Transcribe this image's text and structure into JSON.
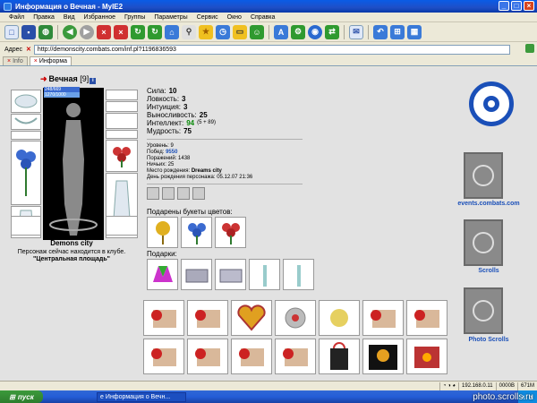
{
  "window": {
    "title": "Информация о Вечная - MyIE2"
  },
  "menu": [
    "Файл",
    "Правка",
    "Вид",
    "Избранное",
    "Группы",
    "Параметры",
    "Сервис",
    "Окно",
    "Справка"
  ],
  "address": {
    "label": "Адрес",
    "url": "http://demonscity.combats.com/inf.pl?1196836593"
  },
  "tabs": [
    {
      "label": "Info"
    },
    {
      "label": "Информа"
    }
  ],
  "character": {
    "name": "Вечная",
    "level": "[9]",
    "info_icon": "i",
    "hp": "248/669",
    "mp": "1270/1000",
    "city": "Demons city",
    "club_text": "Персонаж сейчас находится в клубе.",
    "location": "\"Центральная площадь\""
  },
  "stats": [
    {
      "label": "Сила:",
      "value": "10"
    },
    {
      "label": "Ловкость:",
      "value": "3"
    },
    {
      "label": "Интуиция:",
      "value": "3"
    },
    {
      "label": "Выносливость:",
      "value": "25"
    },
    {
      "label": "Интеллект:",
      "value": "94",
      "extra": "(5 + 89)"
    },
    {
      "label": "Мудрость:",
      "value": "75"
    }
  ],
  "info": [
    {
      "label": "Уровень:",
      "value": "9"
    },
    {
      "label": "Побед:",
      "value": "9550"
    },
    {
      "label": "Поражений:",
      "value": "1438"
    },
    {
      "label": "Ничьих:",
      "value": "25"
    },
    {
      "label": "Место рождения:",
      "value": "Dreams city"
    },
    {
      "label": "День рождения персонажа:",
      "value": "05.12.07 21:36"
    }
  ],
  "sections": {
    "bouquets": "Подарены букеты цветов:",
    "gifts": "Подарки:"
  },
  "right_links": {
    "events": "events.combats.com",
    "scrolls": "Scrolls",
    "photo": "Photo Scrolls"
  },
  "status": {
    "ip": "192.168.0.11",
    "mem1": "0000B",
    "mem2": "671M"
  },
  "taskbar": {
    "start": "пуск",
    "task": "Информация о Вечн...",
    "watermark": "photo.scrolls.ru"
  },
  "colors": {
    "titlebar": "#0a5ce6",
    "content_bg": "#e2e2e2",
    "accent_blue": "#1a4fb8"
  }
}
